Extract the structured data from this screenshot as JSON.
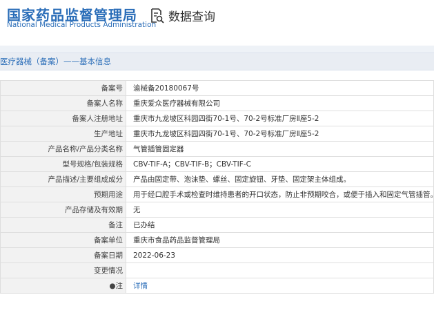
{
  "header": {
    "logo_cn": "国家药品监督管理局",
    "logo_en": "National Medical Products Administration",
    "query_icon": "document-search-icon",
    "query_label": "数据查询"
  },
  "section_title": "医疗器械（备案）——基本信息",
  "rows": [
    {
      "label": "备案号",
      "value": "渝械备20180067号"
    },
    {
      "label": "备案人名称",
      "value": "重庆爱众医疗器械有限公司"
    },
    {
      "label": "备案人注册地址",
      "value": "重庆市九龙坡区科园四街70-1号、70-2号标准厂房Ⅱ座5-2"
    },
    {
      "label": "生产地址",
      "value": "重庆市九龙坡区科园四街70-1号、70-2号标准厂房Ⅱ座5-2"
    },
    {
      "label": "产品名称/产品分类名称",
      "value": "气管插管固定器"
    },
    {
      "label": "型号规格/包装规格",
      "value": "CBV-TIF-A；CBV-TIF-B；CBV-TIF-C"
    },
    {
      "label": "产品描述/主要组成成分",
      "value": "产品由固定带、泡沫垫、螺丝、固定旋钮、牙垫、固定架主体组成。"
    },
    {
      "label": "预期用途",
      "value": "用于经口腔手术或检查时维持患者的开口状态，防止非预期咬合，或便于插入和固定气管插管。"
    },
    {
      "label": "产品存储及有效期",
      "value": "无"
    },
    {
      "label": "备注",
      "value": "已办结"
    },
    {
      "label": "备案单位",
      "value": "重庆市食品药品监督管理局"
    },
    {
      "label": "备案日期",
      "value": "2022-06-23"
    },
    {
      "label": "变更情况",
      "value": ""
    },
    {
      "label": "●注",
      "value": "详情",
      "link": true
    }
  ]
}
